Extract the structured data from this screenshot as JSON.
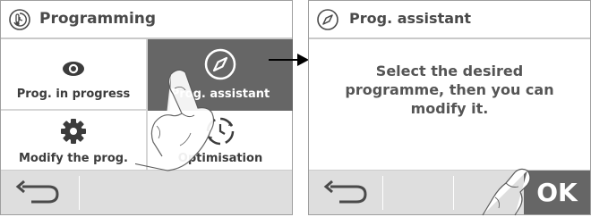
{
  "left_screen": {
    "title": "Programming",
    "header_icon": "thermometer-clock-icon",
    "tiles": [
      {
        "label": "Prog. in progress",
        "icon": "eye-icon"
      },
      {
        "label": "Prog. assistant",
        "icon": "compass-icon"
      },
      {
        "label": "Modify the prog.",
        "icon": "gear-icon"
      },
      {
        "label": "Optimisation",
        "icon": "clock-cycle-icon"
      }
    ],
    "footer": {
      "back_icon": "back-arrow-icon"
    }
  },
  "right_screen": {
    "title": "Prog. assistant",
    "header_icon": "compass-icon",
    "message": [
      "Select the desired",
      "programme, then you can",
      "modify it."
    ],
    "footer": {
      "back_icon": "back-arrow-icon",
      "ok_label": "OK"
    }
  },
  "colors": {
    "selected_tile": "#666666",
    "footer": "#dedede",
    "text": "#4a4a4a"
  }
}
